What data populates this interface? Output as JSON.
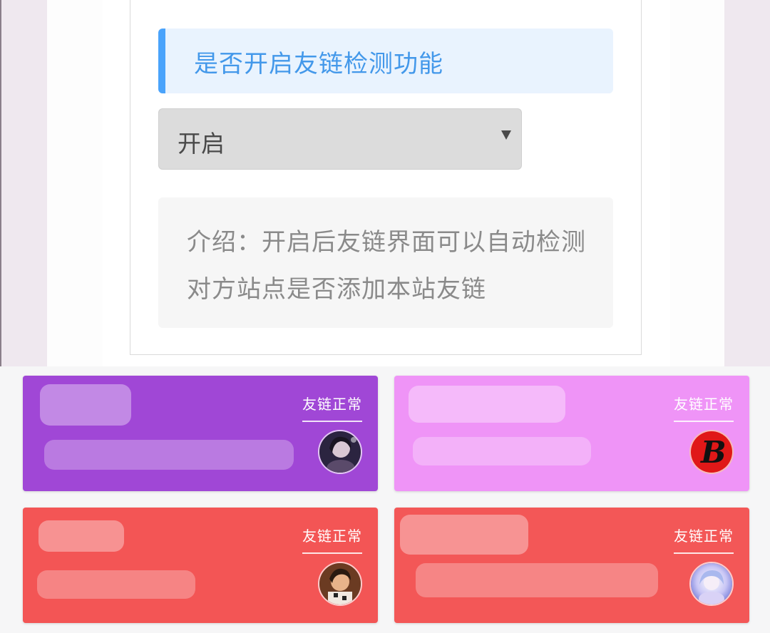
{
  "settings": {
    "title": "是否开启友链检测功能",
    "select_value": "开启",
    "description": "介绍：开启后友链界面可以自动检测对方站点是否添加本站友链"
  },
  "links": [
    {
      "status": "友链正常",
      "avatar_icon": "person-photo-icon",
      "color": "#a047d6"
    },
    {
      "status": "友链正常",
      "avatar_icon": "letter-b-icon",
      "color": "#ef94f7",
      "avatar_text": "B"
    },
    {
      "status": "友链正常",
      "avatar_icon": "person-photo-icon",
      "color": "#f35555"
    },
    {
      "status": "友链正常",
      "avatar_icon": "anime-character-icon",
      "color": "#f35757"
    }
  ],
  "colors": {
    "accent_blue": "#4aa3fb",
    "title_text": "#4398ea"
  }
}
